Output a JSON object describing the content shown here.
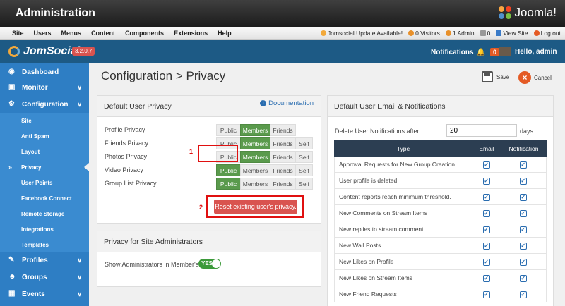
{
  "admin_bar": {
    "title": "Administration",
    "brand": "Joomla!"
  },
  "menu": {
    "items": [
      "Site",
      "Users",
      "Menus",
      "Content",
      "Components",
      "Extensions",
      "Help"
    ],
    "update_notice": "Jomsocial Update Available!",
    "visitors": "0 Visitors",
    "admins": "1 Admin",
    "messages": "0",
    "view_site": "View Site",
    "logout": "Log out"
  },
  "jomsocial": {
    "logo": "JomSocial",
    "version": "3.2.0.7",
    "notifications_label": "Notifications",
    "notifications_count": "0",
    "greeting": "Hello, admin"
  },
  "sidebar": {
    "dashboard": "Dashboard",
    "monitor": "Monitor",
    "configuration": "Configuration",
    "sub_items": [
      "Site",
      "Anti Spam",
      "Layout",
      "Privacy",
      "User Points",
      "Facebook Connect",
      "Remote Storage",
      "Integrations",
      "Templates"
    ],
    "profiles": "Profiles",
    "groups": "Groups",
    "events": "Events"
  },
  "page": {
    "title": "Configuration > Privacy",
    "save_label": "Save",
    "cancel_label": "Cancel"
  },
  "privacy_panel": {
    "title": "Default User Privacy",
    "doc_link": "Documentation",
    "rows": [
      {
        "label": "Profile Privacy",
        "options": [
          "Public",
          "Members",
          "Friends"
        ],
        "selected": "Members"
      },
      {
        "label": "Friends Privacy",
        "options": [
          "Public",
          "Members",
          "Friends",
          "Self"
        ],
        "selected": "Members"
      },
      {
        "label": "Photos Privacy",
        "options": [
          "Public",
          "Members",
          "Friends",
          "Self"
        ],
        "selected": "Members"
      },
      {
        "label": "Video Privacy",
        "options": [
          "Public",
          "Members",
          "Friends",
          "Self"
        ],
        "selected": "Public"
      },
      {
        "label": "Group List Privacy",
        "options": [
          "Public",
          "Members",
          "Friends",
          "Self"
        ],
        "selected": "Public"
      }
    ],
    "reset_button": "Reset existing user's privacy.",
    "annotation_1": "1",
    "annotation_2": "2"
  },
  "admin_panel": {
    "title": "Privacy for Site Administrators",
    "show_admins_label": "Show Administrators in Member's Lists",
    "toggle_label": "YES"
  },
  "notifications_panel": {
    "title": "Default User Email & Notifications",
    "delete_label": "Delete User Notifications after",
    "delete_value": "20",
    "delete_unit": "days",
    "columns": [
      "Type",
      "Email",
      "Notification"
    ],
    "rows": [
      {
        "type": "Approval Requests for New Group Creation",
        "email": true,
        "notification": true
      },
      {
        "type": "User profile is deleted.",
        "email": true,
        "notification": true
      },
      {
        "type": "Content reports reach minimum threshold.",
        "email": true,
        "notification": true
      },
      {
        "type": "New Comments on Stream Items",
        "email": true,
        "notification": true
      },
      {
        "type": "New replies to stream comment.",
        "email": true,
        "notification": true
      },
      {
        "type": "New Wall Posts",
        "email": true,
        "notification": true
      },
      {
        "type": "New Likes on Profile",
        "email": true,
        "notification": true
      },
      {
        "type": "New Likes on Stream Items",
        "email": true,
        "notification": true
      },
      {
        "type": "New Friend Requests",
        "email": true,
        "notification": true
      }
    ]
  },
  "colors": {
    "sidebar": "#2e7ec4",
    "header": "#1d5a85",
    "selected": "#5a9a4c",
    "danger": "#d9534f",
    "annotation": "#e01010"
  }
}
